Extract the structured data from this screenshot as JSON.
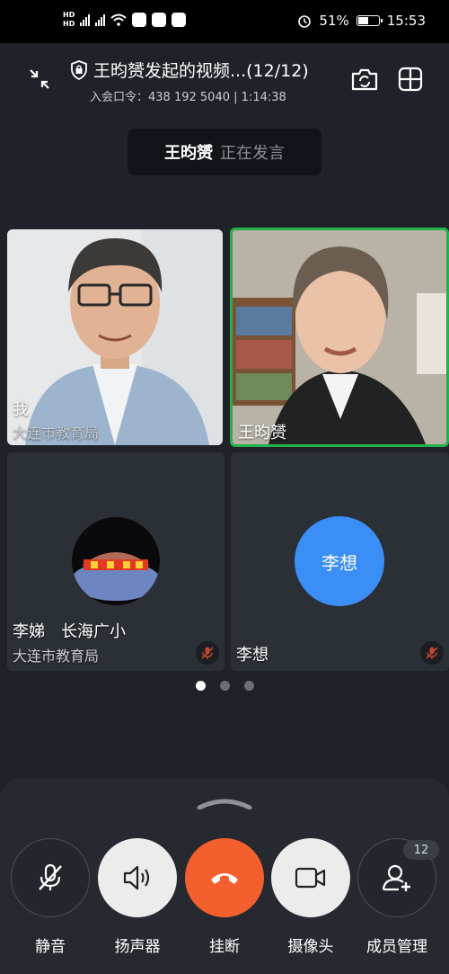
{
  "status_bar": {
    "battery": "51%",
    "time": "15:53",
    "battery_level": 0.51
  },
  "header": {
    "title": "王昀赟发起的视频...(12/12)",
    "meeting_code_label": "入会口令：",
    "meeting_code": "438 192 5040",
    "separator": "|",
    "elapsed": "1:14:38"
  },
  "speaker": {
    "name": "王昀赟",
    "status": "正在发言"
  },
  "participants": [
    {
      "name": "我",
      "org": "大连市教育局",
      "video": true
    },
    {
      "name": "王昀赟",
      "org": "",
      "video": true,
      "active": true
    },
    {
      "name": "李娣　长海广小",
      "org": "大连市教育局",
      "video": false,
      "muted": true
    },
    {
      "name": "李想",
      "org": "",
      "video": false,
      "muted": true,
      "avatar_text": "李想",
      "avatar_color": "#3a8ef6"
    }
  ],
  "pagination": {
    "pages": 3,
    "current": 1
  },
  "controls": {
    "mute": "静音",
    "speaker": "扬声器",
    "hangup": "挂断",
    "camera": "摄像头",
    "members": "成员管理",
    "members_count": "12"
  },
  "colors": {
    "hangup": "#f4602d",
    "active_border": "#21b24b",
    "avatar_blue": "#3a8ef6"
  }
}
